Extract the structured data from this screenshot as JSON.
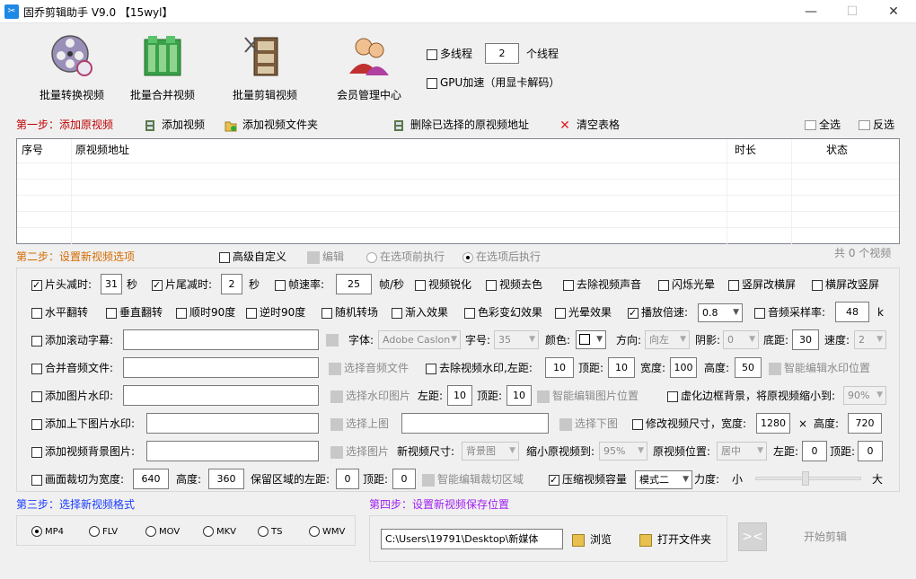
{
  "window": {
    "title": "固乔剪辑助手 V9.0 【15wyl】",
    "app_icon": "scissors-icon",
    "minimize": "—",
    "maximize": "☐",
    "close": "✕"
  },
  "toolbar": {
    "buttons": [
      {
        "label": "批量转换视频",
        "icon": "film-reel-icon"
      },
      {
        "label": "批量合并视频",
        "icon": "merge-film-icon"
      },
      {
        "label": "批量剪辑视频",
        "icon": "cut-film-icon"
      },
      {
        "label": "会员管理中心",
        "icon": "users-icon"
      }
    ],
    "multithread_label": "多线程",
    "thread_count": "2",
    "thread_unit": "个线程",
    "gpu_label": "GPU加速（用显卡解码）"
  },
  "step1": {
    "label": "第一步：添加原视频",
    "add_video": "添加视频",
    "add_folder": "添加视频文件夹",
    "delete_selected": "删除已选择的原视频地址",
    "clear_table": "清空表格",
    "select_all": "全选",
    "invert": "反选"
  },
  "table": {
    "columns": [
      "序号",
      "原视频地址",
      "时长",
      "状态"
    ]
  },
  "step2": {
    "label": "第二步：设置新视频选项",
    "advanced": "高级自定义",
    "edit": "编辑",
    "before": "在选项前执行",
    "after": "在选项后执行",
    "count": "共 0 个视频"
  },
  "row1": {
    "head_cut": "片头减时:",
    "head_val": "31",
    "sec1": "秒",
    "tail_cut": "片尾减时:",
    "tail_val": "2",
    "sec2": "秒",
    "fps": "帧速率:",
    "fps_val": "25",
    "fps_unit": "帧/秒",
    "sharpen": "视频锐化",
    "decolor": "视频去色",
    "remove_audio": "去除视频声音",
    "flash": "闪烁光晕",
    "v2h": "竖屏改横屏",
    "h2v": "横屏改竖屏"
  },
  "row2": {
    "hflip": "水平翻转",
    "vflip": "垂直翻转",
    "cw90": "顺时90度",
    "ccw90": "逆时90度",
    "random_trans": "随机转场",
    "fade_in": "渐入效果",
    "color_change": "色彩变幻效果",
    "halo": "光晕效果",
    "speed": "播放倍速:",
    "speed_val": "0.8",
    "audio_rate": "音频采样率:",
    "audio_rate_val": "48",
    "audio_unit": "k"
  },
  "row3": {
    "scroll_sub": "添加滚动字幕:",
    "font": "字体:",
    "font_val": "Adobe Caslon",
    "size": "字号:",
    "size_val": "35",
    "color": "颜色:",
    "direction": "方向:",
    "direction_val": "向左",
    "shadow": "阴影:",
    "shadow_val": "0",
    "bottom": "底距:",
    "bottom_val": "30",
    "speed": "速度:",
    "speed_val": "2"
  },
  "row4": {
    "merge_audio": "合并音频文件:",
    "choose_audio": "选择音频文件",
    "remove_wm": "去除视频水印,左距:",
    "left_val": "10",
    "top": "顶距:",
    "top_val": "10",
    "width": "宽度:",
    "width_val": "100",
    "height": "高度:",
    "height_val": "50",
    "smart_wm": "智能编辑水印位置"
  },
  "row5": {
    "img_wm": "添加图片水印:",
    "choose_wm": "选择水印图片",
    "left": "左距:",
    "left_val": "10",
    "top": "顶距:",
    "top_val": "10",
    "smart_img": "智能编辑图片位置",
    "blur_bg": "虚化边框背景，将原视频缩小到:",
    "blur_val": "90%"
  },
  "row6": {
    "topbottom_img": "添加上下图片水印:",
    "choose_top": "选择上图",
    "choose_bottom": "选择下图",
    "resize": "修改视频尺寸，宽度:",
    "width_val": "1280",
    "times": "×",
    "height": "高度:",
    "height_val": "720"
  },
  "row7": {
    "bg_img": "添加视频背景图片:",
    "choose_img": "选择图片",
    "new_size": "新视频尺寸:",
    "new_size_val": "背景图",
    "shrink": "缩小原视频到:",
    "shrink_val": "95%",
    "position": "原视频位置:",
    "position_val": "居中",
    "left": "左距:",
    "left_val": "0",
    "top": "顶距:",
    "top_val": "0"
  },
  "row8": {
    "crop": "画面裁切为宽度:",
    "crop_w": "640",
    "height": "高度:",
    "crop_h": "360",
    "keep_left": "保留区域的左距:",
    "keep_left_val": "0",
    "top": "顶距:",
    "top_val": "0",
    "smart_crop": "智能编辑裁切区域",
    "compress": "压缩视频容量",
    "mode_val": "模式二",
    "strength": "力度:",
    "small": "小",
    "big": "大"
  },
  "step3": {
    "label": "第三步：选择新视频格式",
    "formats": [
      "MP4",
      "FLV",
      "MOV",
      "MKV",
      "TS",
      "WMV"
    ]
  },
  "step4": {
    "label": "第四步：设置新视频保存位置",
    "path": "C:\\Users\\19791\\Desktop\\新媒体",
    "browse": "浏览",
    "open_folder": "打开文件夹",
    "start": "开始剪辑"
  }
}
